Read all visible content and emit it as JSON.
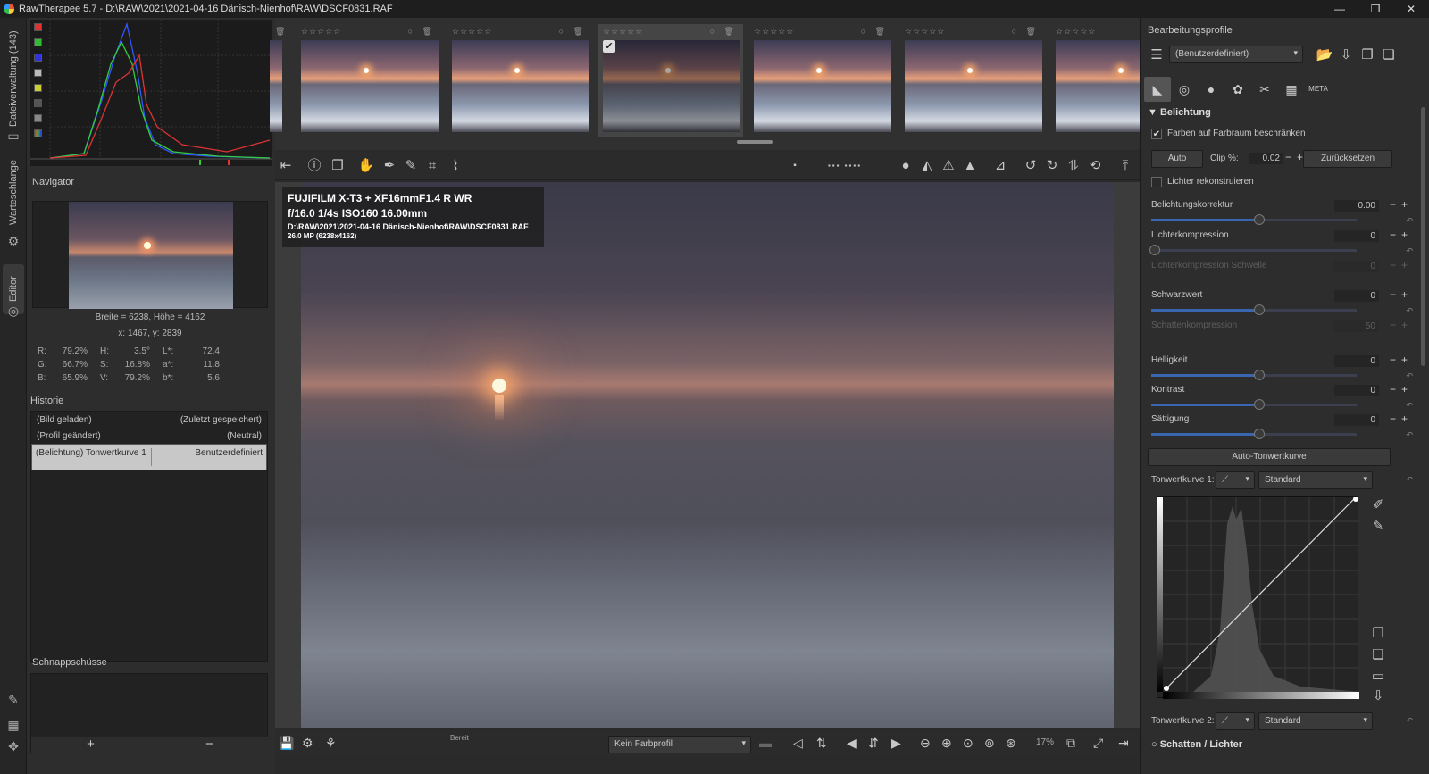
{
  "window": {
    "title": "RawTherapee 5.7 - D:\\RAW\\2021\\2021-04-16 Dänisch-Nienhof\\RAW\\DSCF0831.RAF",
    "minimize": "—",
    "maximize": "❐",
    "close": "✕"
  },
  "left_tabs": {
    "file_browser": "Dateiverwaltung (143)",
    "queue": "Warteschlange",
    "editor": "Editor"
  },
  "navigator": {
    "title": "Navigator",
    "dims": "Breite = 6238, Höhe = 4162",
    "coords": "x: 1467, y: 2839",
    "rows": [
      {
        "l1": "R:",
        "v1": "79.2%",
        "l2": "H:",
        "v2": "3.5°",
        "l3": "L*:",
        "v3": "72.4"
      },
      {
        "l1": "G:",
        "v1": "66.7%",
        "l2": "S:",
        "v2": "16.8%",
        "l3": "a*:",
        "v3": "11.8"
      },
      {
        "l1": "B:",
        "v1": "65.9%",
        "l2": "V:",
        "v2": "79.2%",
        "l3": "b*:",
        "v3": "5.6"
      }
    ]
  },
  "history": {
    "title": "Historie",
    "items": [
      {
        "left": "(Bild geladen)",
        "right": "(Zuletzt gespeichert)"
      },
      {
        "left": "(Profil geändert)",
        "right": "(Neutral)"
      },
      {
        "left": "(Belichtung) Tonwertkurve 1",
        "right": "Benutzerdefiniert"
      }
    ]
  },
  "snapshots": {
    "title": "Schnappschüsse",
    "add": "+",
    "remove": "−"
  },
  "filmstrip": {
    "stars": "☆☆☆☆☆",
    "actions": "○ 🗑"
  },
  "exif": {
    "line1": "FUJIFILM X-T3 + XF16mmF1.4 R WR",
    "line2": "f/16.0  1/4s  ISO160  16.00mm",
    "line3": "D:\\RAW\\2021\\2021-04-16 Dänisch-Nienhof\\RAW\\DSCF0831.RAF",
    "line4": "26.0 MP (6238x4162)"
  },
  "statusbar": {
    "status": "Bereit",
    "color_profile": "Kein Farbprofil",
    "zoom": "17%"
  },
  "right": {
    "profiles_title": "Bearbeitungsprofile",
    "profile_value": "(Benutzerdefiniert)",
    "section": "Belichtung",
    "limit_gamut": "Farben auf Farbraum beschränken",
    "auto": "Auto",
    "clip_label": "Clip %:",
    "clip_value": "0.02",
    "reset": "Zurücksetzen",
    "reconstruct": "Lichter rekonstruieren",
    "controls": [
      {
        "label": "Belichtungskorrektur",
        "value": "0.00"
      },
      {
        "label": "Lichterkompression",
        "value": "0"
      },
      {
        "label": "Lichterkompression Schwelle",
        "value": "0"
      },
      {
        "label": "Schwarzwert",
        "value": "0"
      },
      {
        "label": "Schattenkompression",
        "value": "50"
      },
      {
        "label": "Helligkeit",
        "value": "0"
      },
      {
        "label": "Kontrast",
        "value": "0"
      },
      {
        "label": "Sättigung",
        "value": "0"
      }
    ],
    "auto_curve": "Auto-Tonwertkurve",
    "curve1_label": "Tonwertkurve 1:",
    "curve1_type": "Standard",
    "curve2_label": "Tonwertkurve 2:",
    "curve2_type": "Standard",
    "next_section": "Schatten / Lichter"
  },
  "colors": {
    "accent": "#3a66b0",
    "bg": "#2d2d2d"
  }
}
